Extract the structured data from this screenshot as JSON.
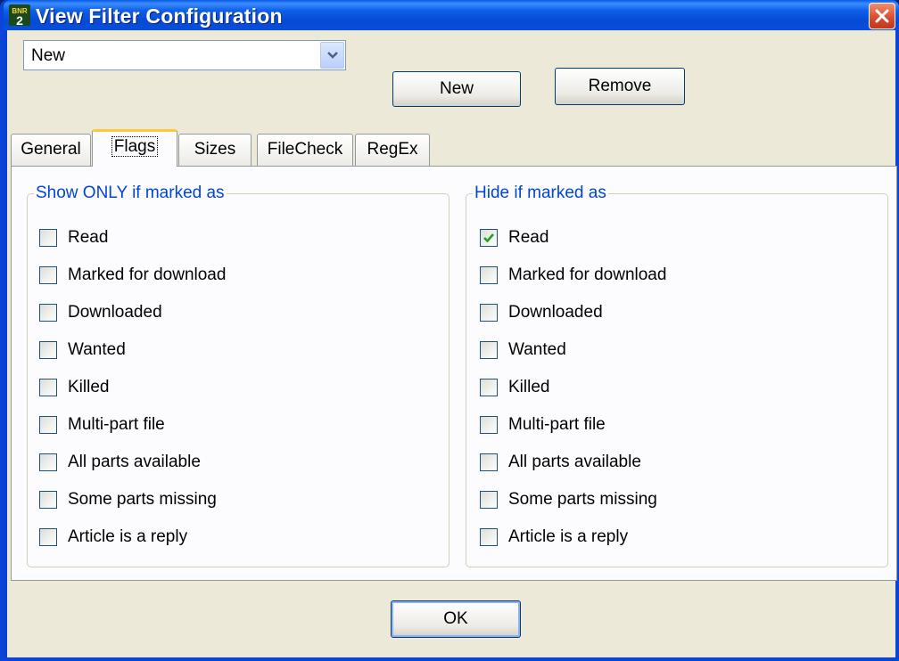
{
  "window": {
    "title": "View Filter Configuration",
    "app_icon": "bnr2-app-icon",
    "close_icon": "close-icon"
  },
  "filter_select": {
    "value": "New",
    "arrow_icon": "chevron-down-icon"
  },
  "buttons": {
    "new": "New",
    "remove": "Remove",
    "ok": "OK"
  },
  "tabs": [
    {
      "label": "General",
      "active": false
    },
    {
      "label": "Flags",
      "active": true
    },
    {
      "label": "Sizes",
      "active": false
    },
    {
      "label": "FileCheck",
      "active": false
    },
    {
      "label": "RegEx",
      "active": false
    }
  ],
  "show_only": {
    "title": "Show ONLY if marked as",
    "items": [
      {
        "label": "Read",
        "checked": false
      },
      {
        "label": "Marked for download",
        "checked": false
      },
      {
        "label": "Downloaded",
        "checked": false
      },
      {
        "label": "Wanted",
        "checked": false
      },
      {
        "label": "Killed",
        "checked": false
      },
      {
        "label": "Multi-part file",
        "checked": false
      },
      {
        "label": "All parts available",
        "checked": false
      },
      {
        "label": "Some parts missing",
        "checked": false
      },
      {
        "label": "Article is a reply",
        "checked": false
      }
    ]
  },
  "hide_if": {
    "title": "Hide if marked as",
    "items": [
      {
        "label": "Read",
        "checked": true
      },
      {
        "label": "Marked for download",
        "checked": false
      },
      {
        "label": "Downloaded",
        "checked": false
      },
      {
        "label": "Wanted",
        "checked": false
      },
      {
        "label": "Killed",
        "checked": false
      },
      {
        "label": "Multi-part file",
        "checked": false
      },
      {
        "label": "All parts available",
        "checked": false
      },
      {
        "label": "Some parts missing",
        "checked": false
      },
      {
        "label": "Article is a reply",
        "checked": false
      }
    ]
  },
  "colors": {
    "titlebar": "#0a4fd8",
    "group_title": "#0046d5",
    "check": "#21a121",
    "tab_highlight": "#ffc83c"
  }
}
